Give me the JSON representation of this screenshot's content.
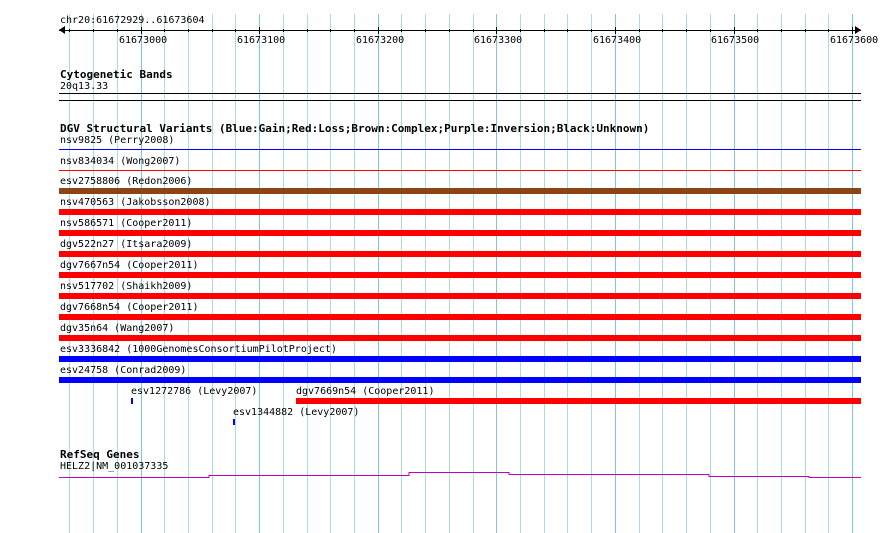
{
  "ruler": {
    "range_label": "chr20:61672929..61673604",
    "ticks": [
      "61673000",
      "61673100",
      "61673200",
      "61673300",
      "61673400",
      "61673500",
      "61673600"
    ]
  },
  "cytobands": {
    "title": "Cytogenetic Bands",
    "band": "20q13.33"
  },
  "dgv": {
    "title": "DGV Structural Variants (Blue:Gain;Red:Loss;Brown:Complex;Purple:Inversion;Black:Unknown)",
    "colors": {
      "gain": "#0000ff",
      "loss": "#ff0000",
      "complex": "#8b4513",
      "inversion": "#800080",
      "unknown": "#000000"
    },
    "variants": [
      {
        "label": "nsv9825 (Perry2008)",
        "type": "gain"
      },
      {
        "label": "nsv834034 (Wong2007)",
        "type": "loss"
      },
      {
        "label": "esv2758806 (Redon2006)",
        "type": "complex"
      },
      {
        "label": "nsv470563 (Jakobsson2008)",
        "type": "loss"
      },
      {
        "label": "nsv586571 (Cooper2011)",
        "type": "loss"
      },
      {
        "label": "dgv522n27 (Itsara2009)",
        "type": "loss"
      },
      {
        "label": "dgv7667n54 (Cooper2011)",
        "type": "loss"
      },
      {
        "label": "nsv517702 (Shaikh2009)",
        "type": "loss"
      },
      {
        "label": "dgv7668n54 (Cooper2011)",
        "type": "loss"
      },
      {
        "label": "dgv35n64 (Wang2007)",
        "type": "loss"
      },
      {
        "label": "esv3336842 (1000GenomesConsortiumPilotProject)",
        "type": "gain"
      },
      {
        "label": "esv24758 (Conrad2009)",
        "type": "gain"
      },
      {
        "label": "esv1272786 (Levy2007)",
        "type": "gain"
      },
      {
        "label": "dgv7669n54 (Cooper2011)",
        "type": "loss"
      },
      {
        "label": "esv1344882 (Levy2007)",
        "type": "gain"
      }
    ]
  },
  "refseq": {
    "title": "RefSeq Genes",
    "gene": "HELZ2|NM_001037335",
    "color": "#c000c0"
  }
}
